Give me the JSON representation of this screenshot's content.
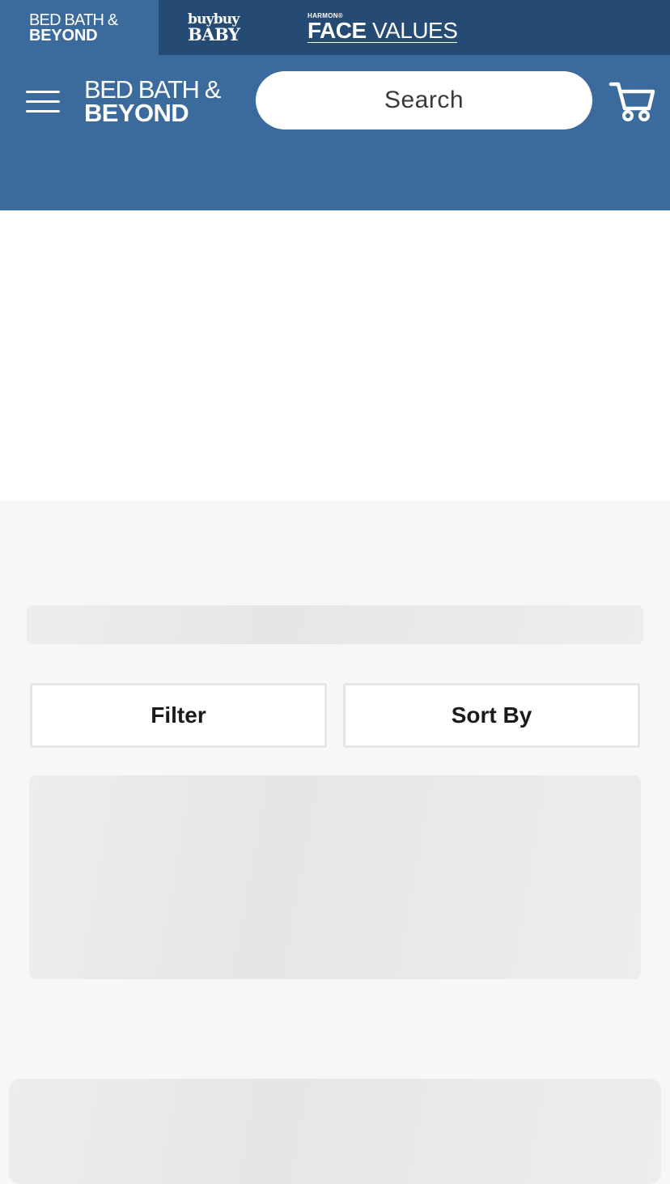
{
  "brand_bar": {
    "tabs": [
      {
        "line1": "BED BATH &",
        "line2": "BEYOND",
        "active": true
      },
      {
        "line1": "buybuy",
        "line2": "BABY",
        "active": false
      },
      {
        "line1": "HARMON®",
        "line2_bold": "FACE",
        "line2_rest": " VALUES",
        "active": false
      }
    ]
  },
  "header": {
    "menu_icon": "hamburger-menu-icon",
    "logo": {
      "line1": "BED BATH &",
      "line2": "BEYOND"
    },
    "search": {
      "placeholder": "Search",
      "value": ""
    },
    "cart_icon": "shopping-cart-icon"
  },
  "controls": {
    "filter_label": "Filter",
    "sort_label": "Sort By"
  },
  "colors": {
    "brand_bar_bg": "#254a74",
    "header_bg": "#3b6a9c",
    "page_bg": "#f7f7f7",
    "skeleton": "#ececec"
  }
}
